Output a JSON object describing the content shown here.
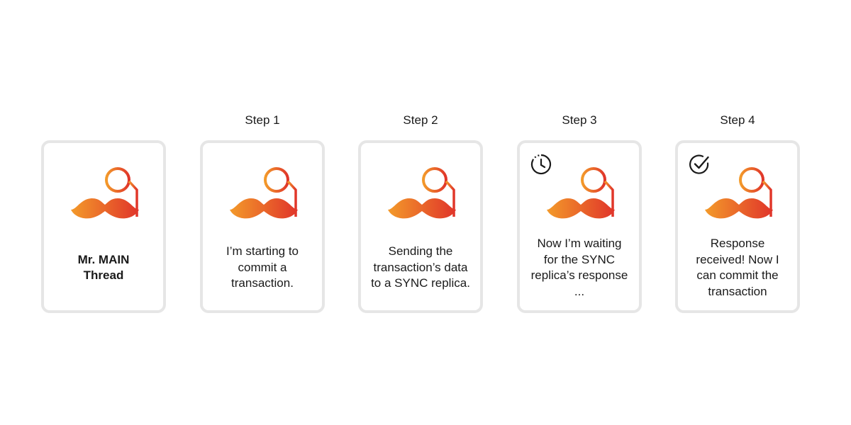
{
  "cards": [
    {
      "step": "",
      "caption": "Mr. MAIN\nThread",
      "icon": "",
      "bold": true
    },
    {
      "step": "Step 1",
      "caption": "I’m starting to\ncommit a\ntransaction.",
      "icon": ""
    },
    {
      "step": "Step 2",
      "caption": "Sending the\ntransaction’s data\nto a SYNC replica.",
      "icon": ""
    },
    {
      "step": "Step 3",
      "caption": "Now I’m waiting\nfor the SYNC\nreplica’s response\n...",
      "icon": "timer-icon"
    },
    {
      "step": "Step 4",
      "caption": "Response\nreceived! Now I\ncan commit the\ntransaction",
      "icon": "checkmark-icon"
    }
  ],
  "colors": {
    "gradient_start": "#f39a2a",
    "gradient_end": "#e0342a",
    "card_border": "#e6e6e6"
  }
}
